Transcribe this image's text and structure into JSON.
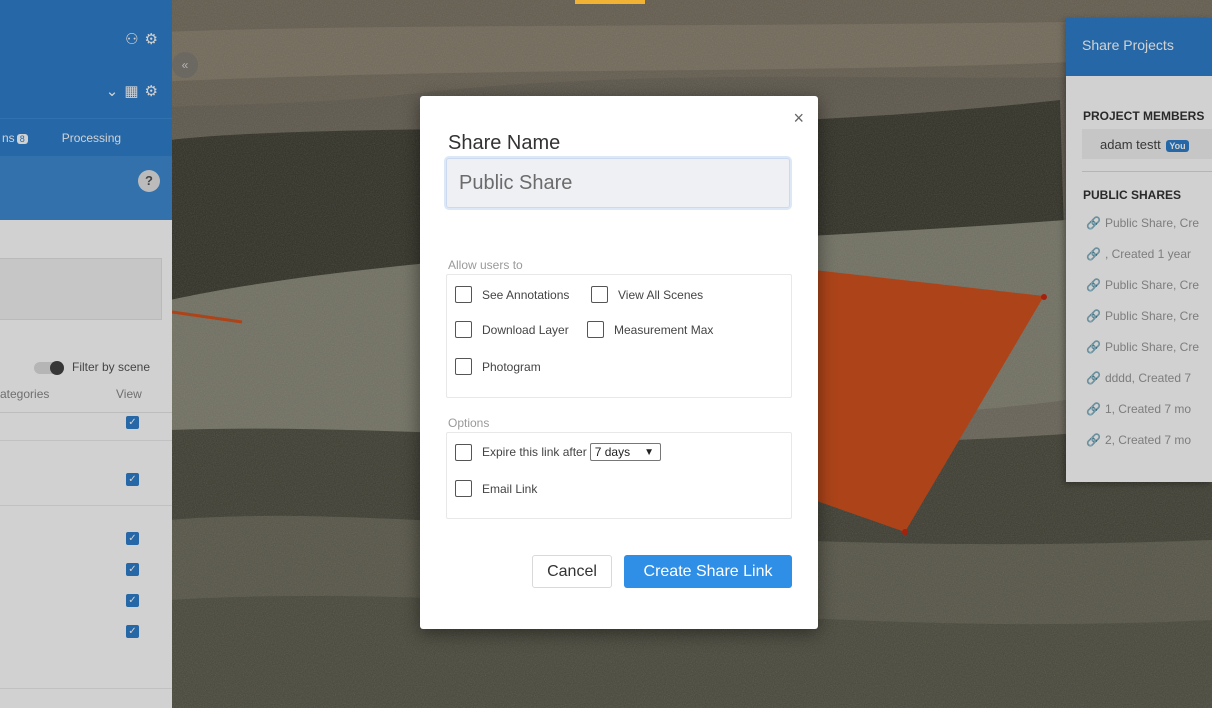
{
  "colors": {
    "accent": "#2f7fcc",
    "primary_button": "#2f8ee5",
    "annotation_polygon": "#d4531f"
  },
  "left_panel": {
    "tabs": [
      {
        "label": "ns",
        "badge": "8"
      },
      {
        "label": "Processing"
      }
    ],
    "filter_label": "Filter by scene",
    "columns": {
      "col1": "ategories",
      "col2": "View"
    },
    "icons": [
      "users-icon",
      "gear-icon",
      "chevron-down-icon",
      "folder-icon",
      "gear-icon",
      "help-icon",
      "collapse-icon"
    ]
  },
  "right_panel": {
    "title": "Share Projects",
    "members_heading": "PROJECT MEMBERS",
    "member": {
      "name": "adam testt",
      "badge": "You"
    },
    "public_heading": "PUBLIC SHARES",
    "shares": [
      "Public Share, Cre",
      ", Created 1 year",
      "Public Share, Cre",
      "Public Share, Cre",
      "Public Share, Cre",
      "dddd, Created 7",
      "1, Created 7 mo",
      "2, Created 7 mo"
    ]
  },
  "modal": {
    "close_label": "×",
    "title": "Share Name",
    "name_placeholder": "Public Share",
    "allow_label": "Allow users to",
    "permissions": {
      "see_annotations": "See Annotations",
      "view_all_scenes": "View All Scenes",
      "download_layer": "Download Layer",
      "measurement_max": "Measurement Max",
      "photogram": "Photogram"
    },
    "options_label": "Options",
    "expire_label": "Expire this link after",
    "expire_value": "7 days",
    "email_label": "Email Link",
    "cancel_label": "Cancel",
    "create_label": "Create Share Link"
  }
}
